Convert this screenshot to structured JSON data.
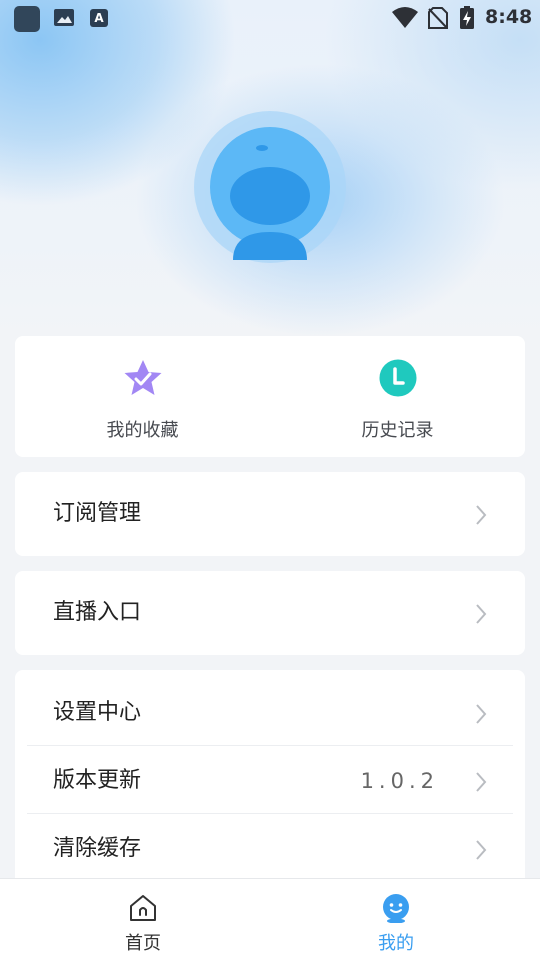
{
  "status_bar": {
    "time": "8:48",
    "notification_badge": "A",
    "icons": [
      "app-icon",
      "image-icon",
      "text-notification-icon",
      "wifi-icon",
      "no-sim-icon",
      "battery-charging-icon"
    ]
  },
  "profile": {
    "avatar_icon": "avatar-icon"
  },
  "quick_actions": [
    {
      "label": "我的收藏",
      "icon": "star-icon",
      "color": "#a287f4"
    },
    {
      "label": "历史记录",
      "icon": "clock-icon",
      "color": "#1fc9be"
    }
  ],
  "menu": {
    "subscription": {
      "label": "订阅管理"
    },
    "live": {
      "label": "直播入口"
    },
    "settings": {
      "label": "设置中心"
    },
    "version": {
      "label": "版本更新",
      "value": "1.0.2"
    },
    "cache": {
      "label": "清除缓存"
    }
  },
  "tab_bar": {
    "tabs": [
      {
        "label": "首页",
        "icon": "home-icon",
        "active": false
      },
      {
        "label": "我的",
        "icon": "profile-face-icon",
        "active": true
      }
    ],
    "active_color": "#3a9ef0",
    "inactive_color": "#333333"
  },
  "colors": {
    "accent": "#3a9ef0",
    "avatar_light": "#5cb8f6",
    "avatar_dark": "#2f98e8",
    "background": "#f2f4f7"
  }
}
